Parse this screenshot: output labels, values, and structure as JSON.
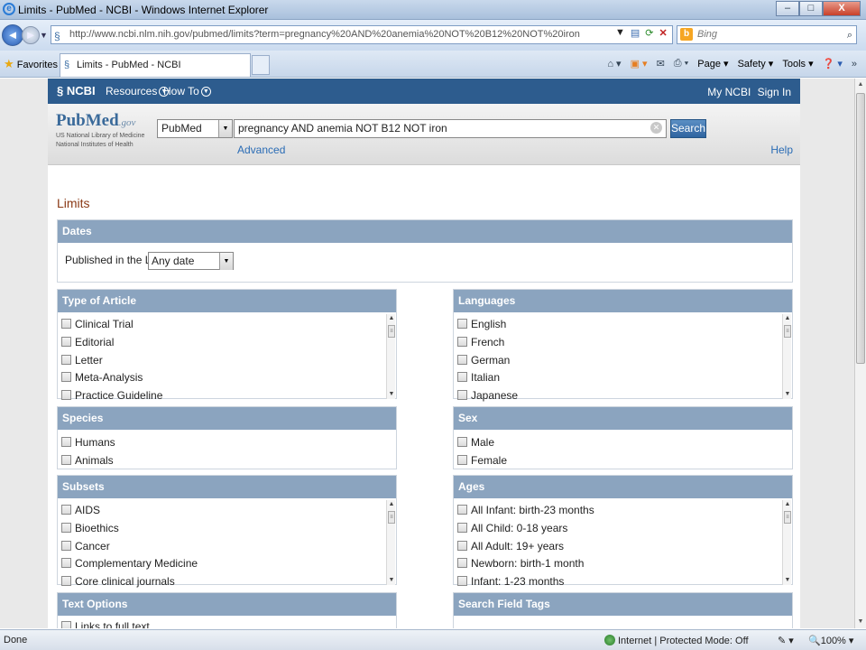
{
  "window": {
    "title": "Limits - PubMed - NCBI - Windows Internet Explorer",
    "minimize": "–",
    "maximize": "□",
    "close": "X"
  },
  "address": {
    "url": "http://www.ncbi.nlm.nih.gov/pubmed/limits?term=pregnancy%20AND%20anemia%20NOT%20B12%20NOT%20iron",
    "search_placeholder": "Bing"
  },
  "tabs": {
    "favorites": "Favorites",
    "active_tab": "Limits - PubMed - NCBI"
  },
  "commands": {
    "page": "Page",
    "safety": "Safety",
    "tools": "Tools"
  },
  "ncbi": {
    "logo": "NCBI",
    "resources": "Resources",
    "howto": "How To",
    "my_ncbi": "My NCBI",
    "sign_in": "Sign In"
  },
  "pubmed": {
    "logo_pub": "Pub",
    "logo_med": "Med",
    "logo_gov": ".gov",
    "logo_line1": "US National Library of Medicine",
    "logo_line2": "National Institutes of Health",
    "db": "PubMed",
    "query": "pregnancy AND anemia NOT B12 NOT iron",
    "search_btn": "Search",
    "advanced": "Advanced",
    "help": "Help"
  },
  "limits": {
    "heading": "Limits",
    "dates": {
      "title": "Dates",
      "label": "Published in the Last:",
      "value": "Any date"
    },
    "type_of_article": {
      "title": "Type of Article",
      "items": [
        "Clinical Trial",
        "Editorial",
        "Letter",
        "Meta-Analysis",
        "Practice Guideline"
      ]
    },
    "languages": {
      "title": "Languages",
      "items": [
        "English",
        "French",
        "German",
        "Italian",
        "Japanese"
      ]
    },
    "species": {
      "title": "Species",
      "items": [
        "Humans",
        "Animals"
      ]
    },
    "sex": {
      "title": "Sex",
      "items": [
        "Male",
        "Female"
      ]
    },
    "subsets": {
      "title": "Subsets",
      "items": [
        "AIDS",
        "Bioethics",
        "Cancer",
        "Complementary Medicine",
        "Core clinical journals"
      ]
    },
    "ages": {
      "title": "Ages",
      "items": [
        "All Infant: birth-23 months",
        "All Child: 0-18 years",
        "All Adult: 19+ years",
        "Newborn: birth-1 month",
        "Infant: 1-23 months"
      ]
    },
    "text_options": {
      "title": "Text Options",
      "items": [
        "Links to full text"
      ]
    },
    "search_field_tags": {
      "title": "Search Field Tags"
    }
  },
  "status": {
    "left": "Done",
    "zone": "Internet | Protected Mode: Off",
    "zoom": "100%"
  }
}
